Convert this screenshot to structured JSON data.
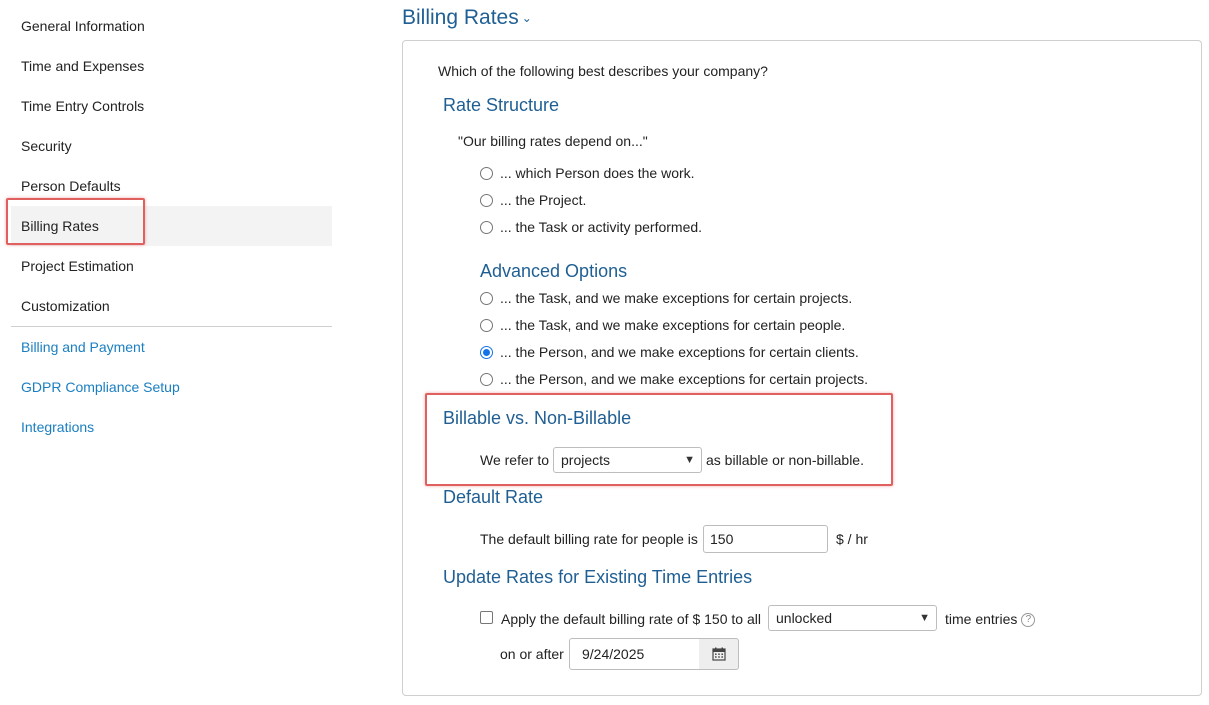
{
  "sidebar": {
    "items": [
      {
        "label": "General Information"
      },
      {
        "label": "Time and Expenses"
      },
      {
        "label": "Time Entry Controls"
      },
      {
        "label": "Security"
      },
      {
        "label": "Person Defaults"
      },
      {
        "label": "Billing Rates"
      },
      {
        "label": "Project Estimation"
      },
      {
        "label": "Customization"
      }
    ],
    "links": [
      {
        "label": "Billing and Payment"
      },
      {
        "label": "GDPR Compliance Setup"
      },
      {
        "label": "Integrations"
      }
    ]
  },
  "page": {
    "title": "Billing Rates",
    "question": "Which of the following best describes your company?"
  },
  "rate_structure": {
    "heading": "Rate Structure",
    "lead": "\"Our billing rates depend on...\"",
    "options": [
      "... which Person does the work.",
      "... the Project.",
      "... the Task or activity performed."
    ]
  },
  "advanced": {
    "heading": "Advanced Options",
    "options": [
      "... the Task, and we make exceptions for certain projects.",
      "... the Task, and we make exceptions for certain people.",
      "... the Person, and we make exceptions for certain clients.",
      "... the Person, and we make exceptions for certain projects."
    ]
  },
  "billable": {
    "heading": "Billable vs. Non-Billable",
    "prefix": "We refer to",
    "selected": "projects",
    "suffix": "as billable or non-billable."
  },
  "default_rate": {
    "heading": "Default Rate",
    "label": "The default billing rate for people is",
    "value": "150",
    "unit": "$ / hr"
  },
  "update_rates": {
    "heading": "Update Rates for Existing Time Entries",
    "apply_label": "Apply the default billing rate of $ 150 to all",
    "entries_selected": "unlocked",
    "entries_suffix": "time entries",
    "help": "?",
    "date_label": "on or after",
    "date_value": "9/24/2025"
  },
  "colors": {
    "accent": "#1f5f93",
    "link": "#1a7fc1",
    "highlight": "#e06060",
    "radio_selected": "#1473e6"
  }
}
